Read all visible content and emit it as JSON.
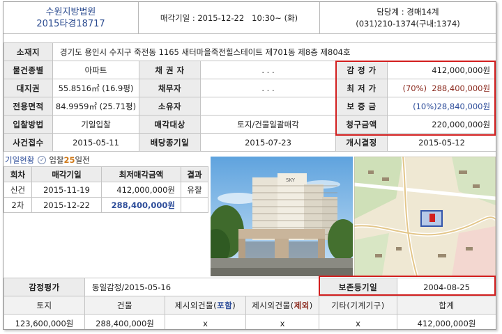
{
  "header": {
    "court": "수원지방법원",
    "case_no": "2015타경18717",
    "sale_date": "매각기일 : 2015-12-22   10:30~ (화)",
    "dept": "담당계 : 경매14계",
    "phone": "(031)210-1374(구내:1374)"
  },
  "info": {
    "addr_label": "소재지",
    "address": "경기도 용인시 수지구 죽전동 1165 새터마을죽전힐스테이트 제701동 제8층 제804호",
    "type_label": "물건종별",
    "type": "아파트",
    "creditor_label": "채 권 자",
    "creditor": ". . .",
    "appraisal_label": "감 정 가",
    "appraisal": "412,000,000원",
    "land_label": "대지권",
    "land": "55.8516㎡ (16.9평)",
    "debtor_label": "채무자",
    "debtor": ". . .",
    "min_label": "최 저 가",
    "min_price": "(70%)  288,400,000원",
    "area_label": "전용면적",
    "area": "84.9959㎡ (25.71평)",
    "owner_label": "소유자",
    "owner": "",
    "deposit_label": "보 증 금",
    "deposit": "(10%)28,840,000원",
    "bid_method_label": "입찰방법",
    "bid_method": "기일입찰",
    "target_label": "매각대상",
    "target": "토지/건물일괄매각",
    "claim_label": "청구금액",
    "claim": "220,000,000원",
    "received_label": "사건접수",
    "received": "2015-05-11",
    "dividend_label": "배당종기일",
    "dividend": "2015-07-23",
    "decision_label": "개시결정",
    "decision": "2015-05-12"
  },
  "bids": {
    "title": "기일현황",
    "check_icon": "check-circle-icon",
    "bid_prefix": "입찰",
    "days": "25",
    "days_suffix": "일전",
    "headers": [
      "회차",
      "매각기일",
      "최저매각금액",
      "결과"
    ],
    "rows": [
      {
        "round": "신건",
        "date": "2015-11-19",
        "amount": "412,000,000원",
        "result": "유찰"
      },
      {
        "round": "2차",
        "date": "2015-12-22",
        "amount": "288,400,000원",
        "result": ""
      }
    ]
  },
  "photo": {
    "sign": "SKY"
  },
  "appraisal_summary": {
    "label": "감정평가",
    "value": "동일감정/2015-05-16",
    "reg_label": "보존등기일",
    "reg_date": "2004-08-25",
    "headers": {
      "land": "토지",
      "building": "건물",
      "incl_pre": "제시외건물(",
      "incl_word": "포함",
      "incl_post": ")",
      "excl_pre": "제시외건물(",
      "excl_word": "제외",
      "excl_post": ")",
      "other": "기타(기계기구)",
      "total": "합계"
    },
    "values": {
      "land": "123,600,000원",
      "building": "288,400,000원",
      "incl": "x",
      "excl": "x",
      "other": "x",
      "total": "412,000,000원"
    }
  },
  "colors": {
    "accent_blue": "#2d4d9a",
    "accent_red": "#8b2a1e",
    "highlight": "#d21f1f",
    "label_bg": "#ececec"
  }
}
